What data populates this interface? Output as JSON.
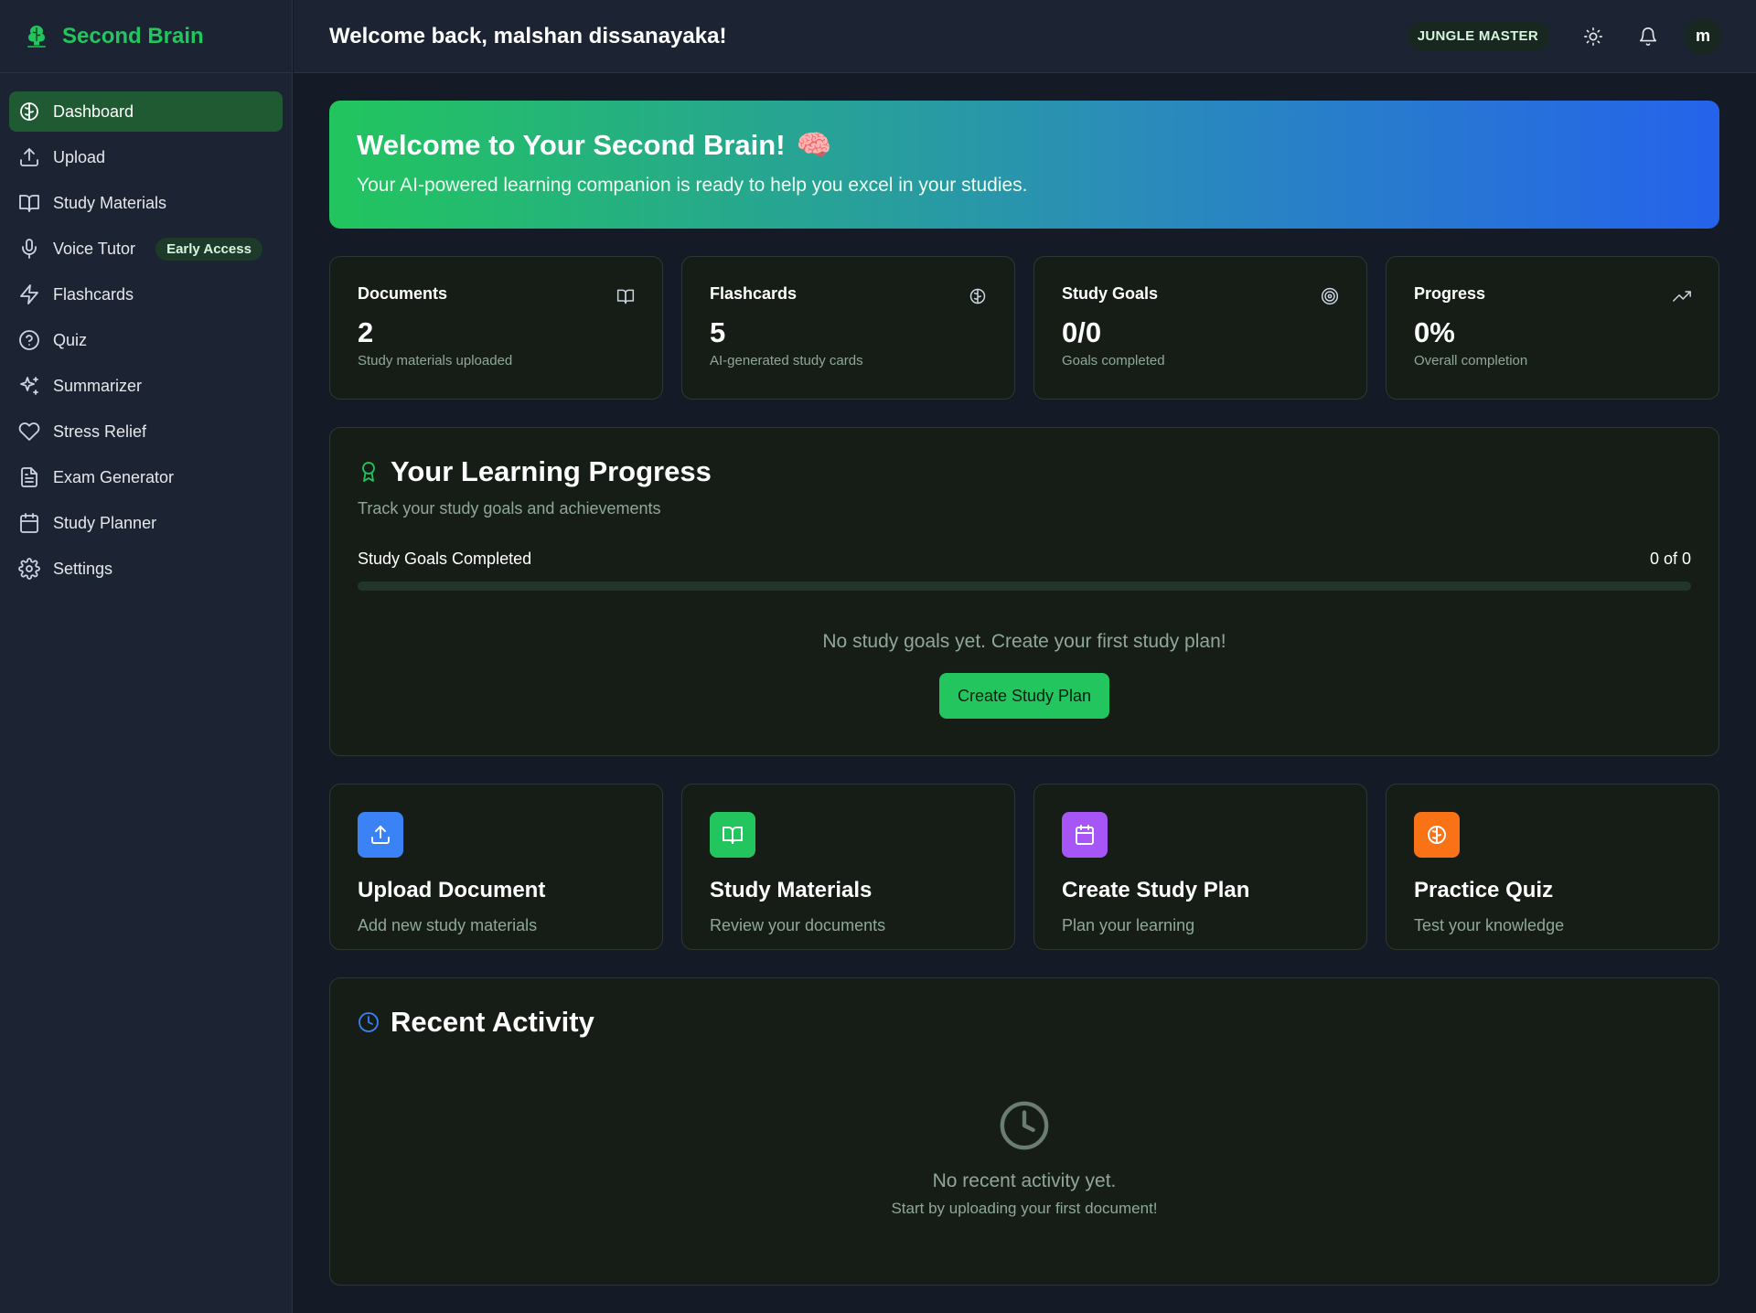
{
  "brand": {
    "name": "Second Brain"
  },
  "sidebar": {
    "items": [
      {
        "label": "Dashboard",
        "icon": "brain-icon",
        "active": true
      },
      {
        "label": "Upload",
        "icon": "upload-icon"
      },
      {
        "label": "Study Materials",
        "icon": "book-icon"
      },
      {
        "label": "Voice Tutor",
        "icon": "microphone-icon",
        "badge": "Early Access"
      },
      {
        "label": "Flashcards",
        "icon": "lightning-icon"
      },
      {
        "label": "Quiz",
        "icon": "question-icon"
      },
      {
        "label": "Summarizer",
        "icon": "sparkles-icon"
      },
      {
        "label": "Stress Relief",
        "icon": "heart-icon"
      },
      {
        "label": "Exam Generator",
        "icon": "document-icon"
      },
      {
        "label": "Study Planner",
        "icon": "calendar-icon"
      },
      {
        "label": "Settings",
        "icon": "gear-icon"
      }
    ]
  },
  "header": {
    "welcome": "Welcome back, malshan dissanayaka!",
    "rank": "JUNGLE MASTER",
    "avatar_initial": "m"
  },
  "hero": {
    "title": "Welcome to Your Second Brain!",
    "emoji": "🧠",
    "subtitle": "Your AI-powered learning companion is ready to help you excel in your studies."
  },
  "stats": [
    {
      "label": "Documents",
      "value": "2",
      "caption": "Study materials uploaded",
      "icon": "book-icon"
    },
    {
      "label": "Flashcards",
      "value": "5",
      "caption": "AI-generated study cards",
      "icon": "brain-icon"
    },
    {
      "label": "Study Goals",
      "value": "0/0",
      "caption": "Goals completed",
      "icon": "target-icon"
    },
    {
      "label": "Progress",
      "value": "0%",
      "caption": "Overall completion",
      "icon": "trending-up-icon"
    }
  ],
  "learning": {
    "title": "Your Learning Progress",
    "subtitle": "Track your study goals and achievements",
    "goals_label": "Study Goals Completed",
    "goals_count": "0 of 0",
    "progress_fraction": 0,
    "empty_text": "No study goals yet. Create your first study plan!",
    "cta_label": "Create Study Plan"
  },
  "actions": [
    {
      "title": "Upload Document",
      "subtitle": "Add new study materials",
      "icon": "upload-icon",
      "color": "#3b82f6"
    },
    {
      "title": "Study Materials",
      "subtitle": "Review your documents",
      "icon": "book-icon",
      "color": "#22c55e"
    },
    {
      "title": "Create Study Plan",
      "subtitle": "Plan your learning",
      "icon": "calendar-icon",
      "color": "#a855f7"
    },
    {
      "title": "Practice Quiz",
      "subtitle": "Test your knowledge",
      "icon": "brain-icon",
      "color": "#f97316"
    }
  ],
  "activity": {
    "title": "Recent Activity",
    "empty_main": "No recent activity yet.",
    "empty_sub": "Start by uploading your first document!"
  },
  "colors": {
    "accent": "#22c55e",
    "active_nav": "#1f5a33",
    "sidebar_bg": "#1c2433",
    "card_bg": "#161d17",
    "activity_icon": "#3b82f6"
  }
}
